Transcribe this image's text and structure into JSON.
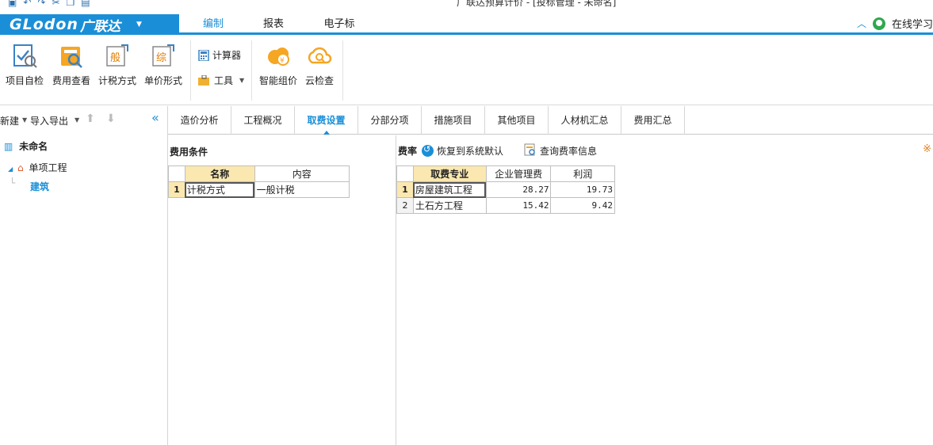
{
  "window": {
    "title": "广联达预算计价 - [投标管理 - 未命名]"
  },
  "app": {
    "logo_text": "GLodon",
    "logo_cn": "广联达"
  },
  "menu": {
    "tabs": [
      {
        "label": "编制",
        "active": true
      },
      {
        "label": "报表",
        "active": false
      },
      {
        "label": "电子标",
        "active": false
      }
    ],
    "online_learning": "在线学习"
  },
  "ribbon": {
    "buttons": [
      {
        "label": "项目自检",
        "icon": "project-check-icon"
      },
      {
        "label": "费用查看",
        "icon": "fee-view-icon"
      },
      {
        "label": "计税方式",
        "icon": "tax-method-icon"
      },
      {
        "label": "单价形式",
        "icon": "unit-price-form-icon"
      }
    ],
    "calculator": "计算器",
    "tools": "工具",
    "smart_price": "智能组价",
    "cloud_check": "云检查"
  },
  "left_panel": {
    "new": "新建",
    "import_export": "导入导出",
    "tree": {
      "root": "未命名",
      "project": "单项工程",
      "unit": "建筑"
    }
  },
  "content_tabs": [
    {
      "label": "造价分析",
      "active": false
    },
    {
      "label": "工程概况",
      "active": false
    },
    {
      "label": "取费设置",
      "active": true
    },
    {
      "label": "分部分项",
      "active": false
    },
    {
      "label": "措施项目",
      "active": false
    },
    {
      "label": "其他项目",
      "active": false
    },
    {
      "label": "人材机汇总",
      "active": false
    },
    {
      "label": "费用汇总",
      "active": false
    }
  ],
  "fee_condition": {
    "title": "费用条件",
    "headers": [
      "名称",
      "内容"
    ],
    "rows": [
      {
        "no": "1",
        "name": "计税方式",
        "content": "一般计税"
      }
    ]
  },
  "fee_rate": {
    "title": "费率",
    "restore_default": "恢复到系统默认",
    "query_info": "查询费率信息",
    "headers": [
      "取费专业",
      "企业管理费",
      "利润"
    ],
    "rows": [
      {
        "no": "1",
        "major": "房屋建筑工程",
        "mgmt": "28.27",
        "profit": "19.73"
      },
      {
        "no": "2",
        "major": "土石方工程",
        "mgmt": "15.42",
        "profit": "9.42"
      }
    ]
  },
  "colors": {
    "accent": "#1a8fd8",
    "header_highlight": "#fbe8b0"
  }
}
